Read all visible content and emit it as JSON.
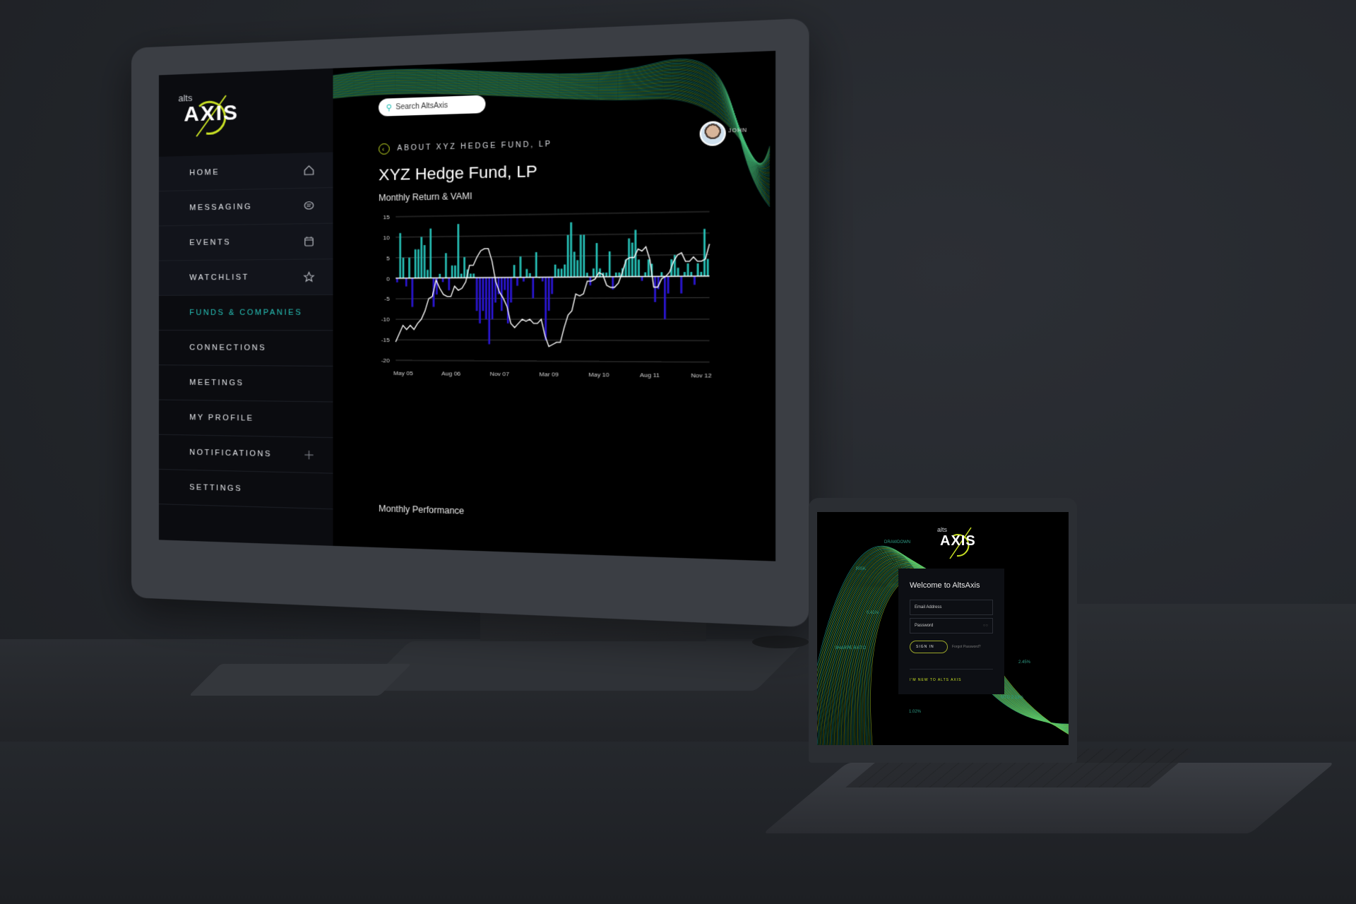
{
  "desktop": {
    "brand": {
      "small": "alts",
      "large": "AXIS"
    },
    "sidebar": {
      "items": [
        {
          "label": "HOME",
          "icon": "home-icon"
        },
        {
          "label": "MESSAGING",
          "icon": "chat-icon"
        },
        {
          "label": "EVENTS",
          "icon": "calendar-icon"
        },
        {
          "label": "WATCHLIST",
          "icon": "star-icon"
        },
        {
          "label": "FUNDS & COMPANIES",
          "active": true
        },
        {
          "label": "CONNECTIONS"
        },
        {
          "label": "MEETINGS"
        },
        {
          "label": "MY PROFILE"
        },
        {
          "label": "NOTIFICATIONS",
          "icon": "plus-icon"
        },
        {
          "label": "SETTINGS"
        }
      ]
    },
    "search": {
      "placeholder": "Search AltsAxis"
    },
    "user": {
      "name": "JOHN"
    },
    "breadcrumb": "ABOUT XYZ HEDGE FUND, LP",
    "title": "XYZ Hedge Fund, LP",
    "chart_section_title": "Monthly Return & VAMI",
    "next_section_title": "Monthly Performance",
    "colors": {
      "accent": "#27c2b8",
      "lime": "#c8e024",
      "negative": "#2b16d6",
      "line": "#ffffff"
    }
  },
  "laptop": {
    "brand": {
      "small": "alts",
      "large": "AXIS"
    },
    "welcome": "Welcome to AltsAxis",
    "email_placeholder": "Email Address",
    "password_placeholder": "Password",
    "signin_label": "SIGN IN",
    "forgot_label": "Forgot Password?",
    "new_user_label": "I'M NEW TO ALTS AXIS",
    "background_stats": [
      "DRAWDOWN",
      "RISK",
      "0.41%",
      "SHARPE RATIO",
      "2.45%",
      "MTD 2.13%",
      "1.02%"
    ]
  },
  "chart_data": {
    "type": "bar",
    "title": "Monthly Return & VAMI",
    "xlabel": "",
    "ylabel": "",
    "ylim": [
      -20,
      15
    ],
    "yticks": [
      15,
      10,
      5,
      0,
      -5,
      -10,
      -15,
      -20
    ],
    "xticks": [
      "May 05",
      "Aug 06",
      "Nov 07",
      "Mar 09",
      "May 10",
      "Aug 11",
      "Nov 12"
    ],
    "grid": true,
    "series": [
      {
        "name": "Monthly Return",
        "type": "bar",
        "values": [
          -1,
          11,
          5,
          -2,
          5,
          -7,
          7,
          7,
          10,
          8,
          2,
          12,
          -7,
          -4,
          1,
          -1,
          6,
          -3,
          3,
          3,
          13,
          1,
          5,
          2,
          1,
          1,
          -8,
          -11,
          -8,
          -10,
          -16,
          -10,
          -6,
          -4,
          -8,
          -3,
          -11,
          -6,
          3,
          -2,
          5,
          -1,
          2,
          1,
          -5,
          6,
          0,
          -1,
          -15,
          -8,
          -4,
          3,
          2,
          2,
          3,
          10,
          13,
          6,
          4,
          10,
          10,
          1,
          -2,
          2,
          8,
          2,
          1,
          1,
          6,
          -3,
          1,
          1,
          2,
          4,
          9,
          8,
          11,
          4,
          -1,
          1,
          4,
          3,
          -6,
          -3,
          1,
          -10,
          -4,
          4,
          5,
          2,
          -4,
          1,
          3,
          1,
          -2,
          3,
          1,
          11,
          4
        ],
        "color_positive": "#27c2b8",
        "color_negative": "#2b16d6"
      },
      {
        "name": "VAMI",
        "type": "line",
        "values": [
          -15.5,
          -13.5,
          -11.5,
          -12.5,
          -11.5,
          -12.5,
          -11,
          -10,
          -8,
          -5,
          -4.5,
          -0.5,
          -2.5,
          -4,
          -4.5,
          -4.5,
          -2,
          -3,
          -2.5,
          -1,
          3,
          3,
          5,
          6.5,
          7,
          7,
          4,
          -1,
          -3.5,
          -5,
          -7,
          -11,
          -12,
          -11,
          -10,
          -10.5,
          -10,
          -11,
          -11,
          -10,
          -14,
          -16.5,
          -16,
          -15.5,
          -15.5,
          -12,
          -9,
          -8,
          -4,
          -4.5,
          -4,
          -1,
          -1,
          -0.5,
          1,
          0.5,
          -2,
          -2.5,
          -2.5,
          -1.5,
          1,
          4,
          4.5,
          4.5,
          6.5,
          6,
          7,
          4,
          -2.5,
          -2.5,
          -0.5,
          0,
          1,
          3.5,
          5,
          5.5,
          3.5,
          3.5,
          4.5,
          3.5,
          3.5,
          4,
          7.5
        ],
        "color": "#ffffff"
      }
    ]
  }
}
